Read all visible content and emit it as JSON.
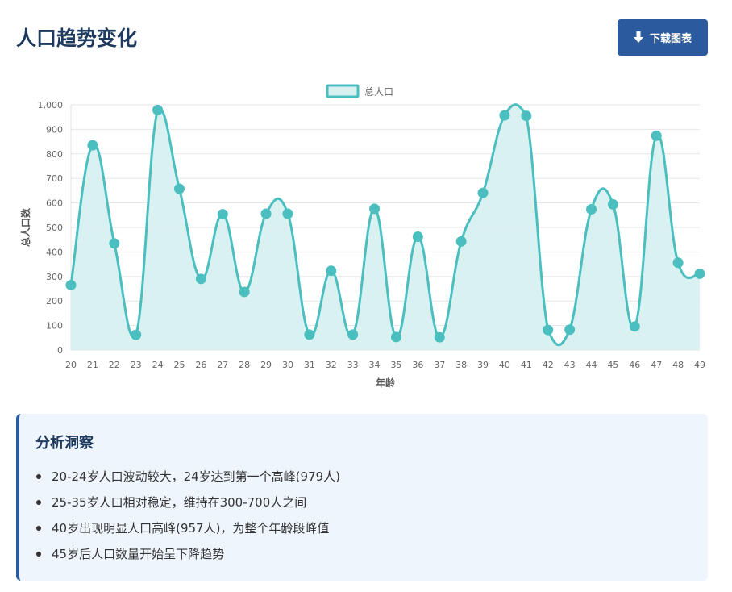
{
  "page": {
    "title": "人口趋势变化",
    "download_label": "下载图表",
    "download_icon": "arrow-down-icon"
  },
  "colors": {
    "series_line": "#4bbfbf",
    "series_fill": "#d8f0f0",
    "button_bg": "#2b5a9e",
    "title_color": "#1f3a5f",
    "insight_bg": "#eef5fd"
  },
  "chart_data": {
    "type": "area",
    "xlabel": "年龄",
    "ylabel": "总人口数",
    "ylim": [
      0,
      1000
    ],
    "yticks": [
      "0",
      "100",
      "200",
      "300",
      "400",
      "500",
      "600",
      "700",
      "800",
      "900",
      "1,000"
    ],
    "legend_position": "top-center",
    "grid": true,
    "x": [
      "20",
      "21",
      "22",
      "23",
      "24",
      "25",
      "26",
      "27",
      "28",
      "29",
      "30",
      "31",
      "32",
      "33",
      "34",
      "35",
      "36",
      "37",
      "38",
      "39",
      "40",
      "41",
      "42",
      "43",
      "44",
      "45",
      "46",
      "47",
      "48",
      "49"
    ],
    "series": [
      {
        "name": "总人口",
        "values": [
          265,
          835,
          435,
          62,
          979,
          658,
          290,
          554,
          237,
          556,
          556,
          63,
          323,
          63,
          576,
          53,
          462,
          52,
          443,
          641,
          957,
          955,
          82,
          83,
          574,
          594,
          96,
          874,
          356,
          311
        ]
      }
    ]
  },
  "insights": {
    "title": "分析洞察",
    "items": [
      "20-24岁人口波动较大，24岁达到第一个高峰(979人)",
      "25-35岁人口相对稳定，维持在300-700人之间",
      "40岁出现明显人口高峰(957人)，为整个年龄段峰值",
      "45岁后人口数量开始呈下降趋势"
    ]
  }
}
